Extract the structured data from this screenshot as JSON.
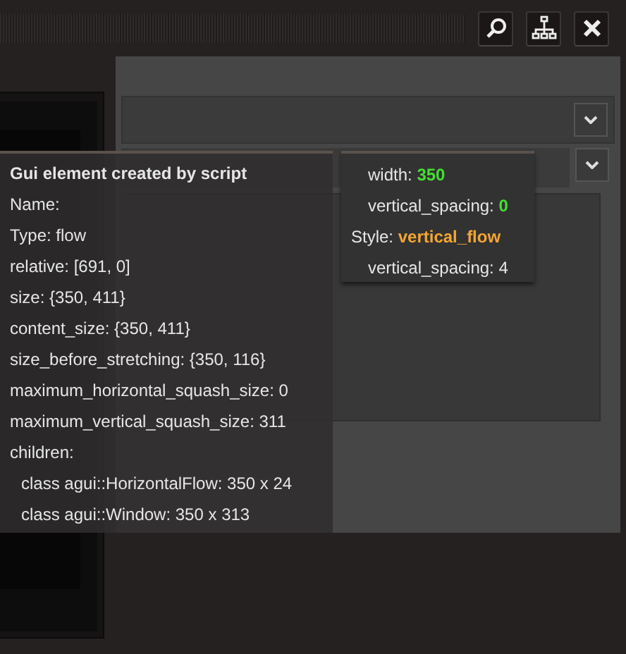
{
  "tooltip": {
    "title": "Gui element created by script",
    "lines": [
      "Name:",
      "Type: flow",
      "relative: [691, 0]",
      "size: {350, 411}",
      "content_size: {350, 411}",
      "size_before_stretching: {350, 116}",
      "maximum_horizontal_squash_size: 0",
      "maximum_vertical_squash_size: 311"
    ],
    "children_label": "children:",
    "children": [
      "class agui::HorizontalFlow:  350 x 24",
      "class agui::Window:  350 x 313"
    ]
  },
  "style_tooltip": {
    "rows": [
      {
        "kind": "override",
        "label": "width:",
        "value": "350"
      },
      {
        "kind": "override",
        "label": "vertical_spacing:",
        "value": "0"
      },
      {
        "kind": "style",
        "label": "Style:",
        "value": "vertical_flow"
      },
      {
        "kind": "property",
        "label": "vertical_spacing:",
        "value": "4"
      }
    ]
  }
}
